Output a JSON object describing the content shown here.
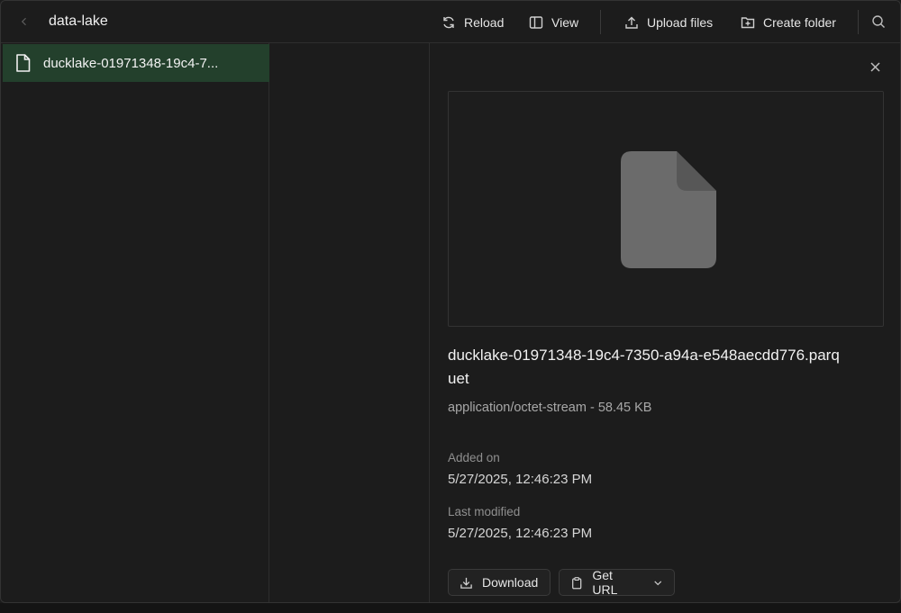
{
  "toolbar": {
    "title": "data-lake",
    "reload_label": "Reload",
    "view_label": "View",
    "upload_label": "Upload files",
    "create_folder_label": "Create folder"
  },
  "file_list": {
    "items": [
      {
        "label": "ducklake-01971348-19c4-7..."
      }
    ]
  },
  "detail": {
    "file_name": "ducklake-01971348-19c4-7350-a94a-e548aecdd776.parquet",
    "meta": "application/octet-stream - 58.45 KB",
    "added_label": "Added on",
    "added_value": "5/27/2025, 12:46:23 PM",
    "modified_label": "Last modified",
    "modified_value": "5/27/2025, 12:46:23 PM",
    "download_label": "Download",
    "get_url_label": "Get URL"
  },
  "colors": {
    "selected_row": "#23402c",
    "background": "#1c1c1c",
    "file_icon": "#6b6b6b"
  }
}
